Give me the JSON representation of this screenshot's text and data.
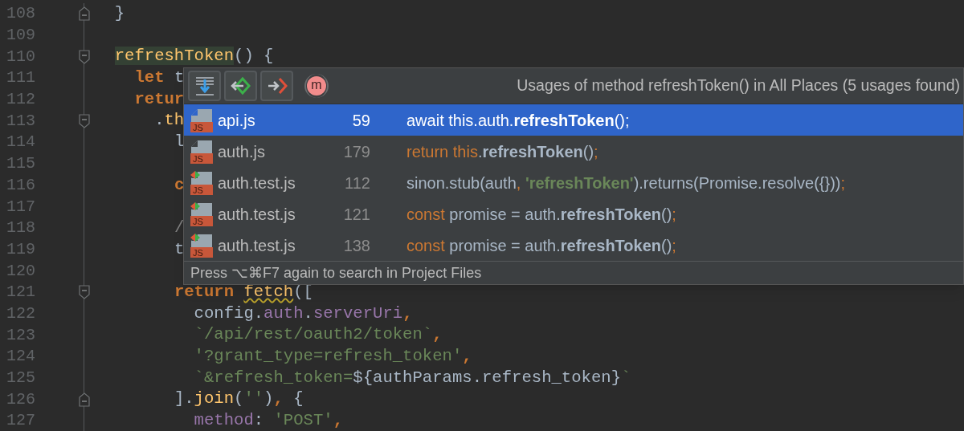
{
  "editor": {
    "lines": [
      {
        "number": "108",
        "fold_end": true,
        "tokens": [
          {
            "kind": "plain",
            "text": "  }"
          }
        ]
      },
      {
        "number": "109"
      },
      {
        "number": "110",
        "fold_start": true,
        "tokens": [
          {
            "kind": "function-highlight",
            "text": "  refreshToken"
          },
          {
            "kind": "plain",
            "text": "() {"
          }
        ]
      },
      {
        "number": "111",
        "tokens": [
          {
            "kind": "keyword",
            "text": "    let"
          },
          {
            "kind": "plain",
            "text": " t"
          }
        ]
      },
      {
        "number": "112",
        "tokens": [
          {
            "kind": "keyword",
            "text": "    retur"
          }
        ]
      },
      {
        "number": "113",
        "fold_start": true,
        "tokens": [
          {
            "kind": "plain",
            "text": "      ."
          },
          {
            "kind": "function",
            "text": "th"
          }
        ]
      },
      {
        "number": "114",
        "tokens": [
          {
            "kind": "plain",
            "text": "        l"
          }
        ]
      },
      {
        "number": "115"
      },
      {
        "number": "116",
        "tokens": [
          {
            "kind": "keyword",
            "text": "        c"
          }
        ]
      },
      {
        "number": "117"
      },
      {
        "number": "118",
        "tokens": [
          {
            "kind": "comment",
            "text": "        /"
          }
        ]
      },
      {
        "number": "119",
        "tokens": [
          {
            "kind": "plain",
            "text": "        t"
          }
        ]
      },
      {
        "number": "120"
      },
      {
        "number": "121",
        "fold_start": true,
        "tokens": [
          {
            "kind": "keyword",
            "text": "        return"
          },
          {
            "kind": "function-warning",
            "text": " fetch"
          },
          {
            "kind": "plain",
            "text": "(["
          }
        ]
      },
      {
        "number": "122",
        "tokens": [
          {
            "kind": "plain",
            "text": "          config."
          },
          {
            "kind": "property",
            "text": "auth"
          },
          {
            "kind": "plain",
            "text": "."
          },
          {
            "kind": "property",
            "text": "serverUri"
          },
          {
            "kind": "keyword",
            "text": ","
          }
        ]
      },
      {
        "number": "123",
        "tokens": [
          {
            "kind": "string",
            "text": "          `/api/rest/oauth2/token`"
          },
          {
            "kind": "keyword",
            "text": ","
          }
        ]
      },
      {
        "number": "124",
        "tokens": [
          {
            "kind": "string",
            "text": "          '?grant_type=refresh_token'"
          },
          {
            "kind": "keyword",
            "text": ","
          }
        ]
      },
      {
        "number": "125",
        "tokens": [
          {
            "kind": "string",
            "text": "          `&refresh_token="
          },
          {
            "kind": "plain",
            "text": "${authParams.refresh_token}"
          },
          {
            "kind": "string",
            "text": "`"
          }
        ]
      },
      {
        "number": "126",
        "fold_end": true,
        "tokens": [
          {
            "kind": "plain",
            "text": "        ]."
          },
          {
            "kind": "function",
            "text": "join"
          },
          {
            "kind": "plain",
            "text": "("
          },
          {
            "kind": "string",
            "text": "''"
          },
          {
            "kind": "plain",
            "text": ")"
          },
          {
            "kind": "keyword",
            "text": ","
          },
          {
            "kind": "plain",
            "text": " {"
          }
        ]
      },
      {
        "number": "127",
        "tokens": [
          {
            "kind": "property",
            "text": "          method"
          },
          {
            "kind": "plain",
            "text": ": "
          },
          {
            "kind": "string",
            "text": "'POST'"
          },
          {
            "kind": "keyword",
            "text": ","
          }
        ]
      }
    ]
  },
  "usages_popup": {
    "toolbar": [
      {
        "kind": "merge",
        "on": true
      },
      {
        "kind": "import",
        "on": true
      },
      {
        "kind": "export",
        "on": true
      },
      {
        "kind": "method",
        "on": false,
        "label": "m"
      }
    ],
    "title": "Usages of method refreshToken() in All Places (5 usages found)",
    "rows": [
      {
        "kind": "js",
        "badge": "JS",
        "file": "api.js",
        "line": "59",
        "selected": true,
        "tokens": [
          {
            "kind": "plain",
            "text": "await this.auth."
          },
          {
            "kind": "match",
            "text": "refreshToken"
          },
          {
            "kind": "plain",
            "text": "();"
          }
        ]
      },
      {
        "kind": "js",
        "badge": "JS",
        "file": "auth.js",
        "line": "179",
        "selected": false,
        "tokens": [
          {
            "kind": "keyword",
            "text": "return this"
          },
          {
            "kind": "plain",
            "text": "."
          },
          {
            "kind": "match",
            "text": "refreshToken"
          },
          {
            "kind": "plain",
            "text": "()"
          },
          {
            "kind": "keyword",
            "text": ";"
          }
        ]
      },
      {
        "kind": "test",
        "badge": "JS",
        "file": "auth.test.js",
        "line": "112",
        "selected": false,
        "tokens": [
          {
            "kind": "plain",
            "text": "sinon.stub(auth"
          },
          {
            "kind": "keyword",
            "text": ", "
          },
          {
            "kind": "match-string",
            "text": "'refreshToken'"
          },
          {
            "kind": "plain",
            "text": ").returns(Promise.resolve({}))"
          },
          {
            "kind": "keyword",
            "text": ";"
          }
        ]
      },
      {
        "kind": "test",
        "badge": "JS",
        "file": "auth.test.js",
        "line": "121",
        "selected": false,
        "tokens": [
          {
            "kind": "keyword",
            "text": "const"
          },
          {
            "kind": "plain",
            "text": " promise = auth."
          },
          {
            "kind": "match",
            "text": "refreshToken"
          },
          {
            "kind": "plain",
            "text": "()"
          },
          {
            "kind": "keyword",
            "text": ";"
          }
        ]
      },
      {
        "kind": "test",
        "badge": "JS",
        "file": "auth.test.js",
        "line": "138",
        "selected": false,
        "tokens": [
          {
            "kind": "keyword",
            "text": "const"
          },
          {
            "kind": "plain",
            "text": " promise = auth."
          },
          {
            "kind": "match",
            "text": "refreshToken"
          },
          {
            "kind": "plain",
            "text": "()"
          },
          {
            "kind": "keyword",
            "text": ";"
          }
        ]
      }
    ],
    "footer": "Press ⌥⌘F7 again to search in Project Files"
  }
}
